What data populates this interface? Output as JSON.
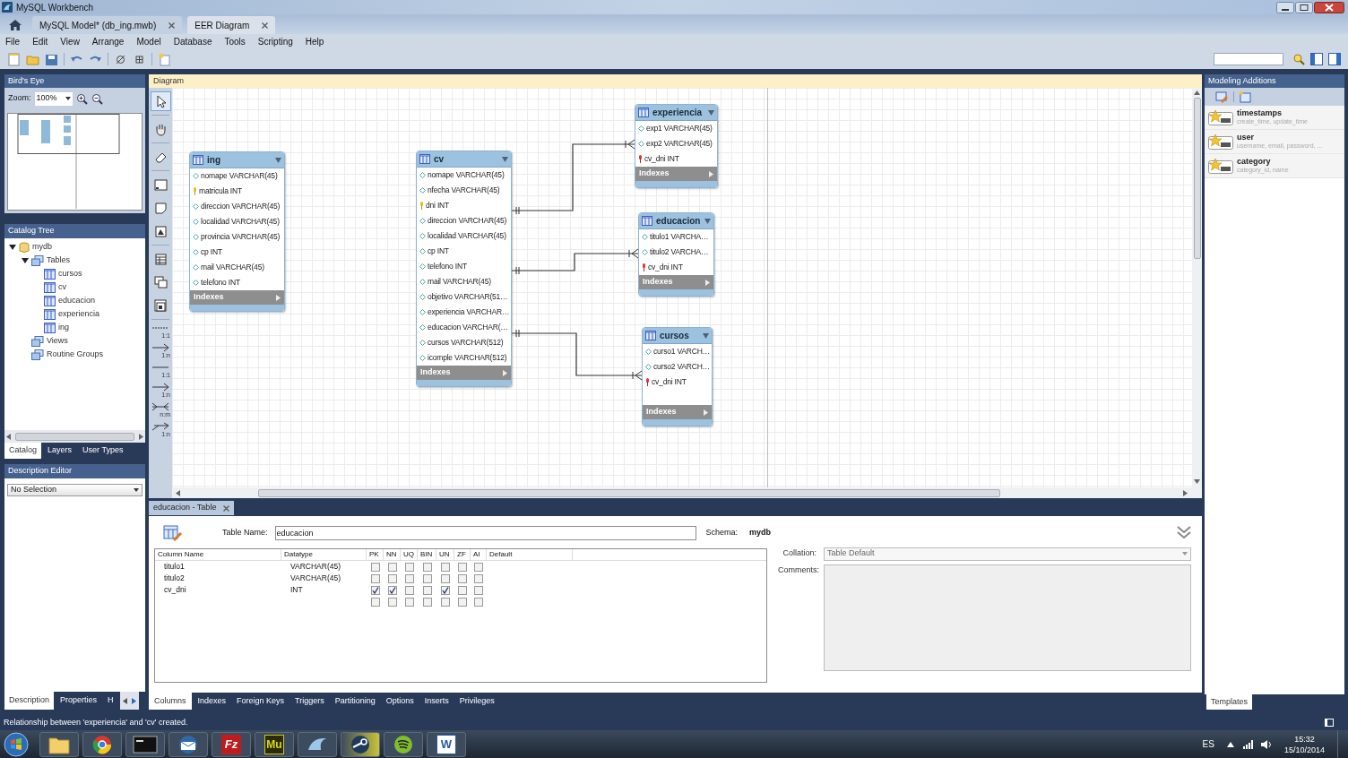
{
  "title_bar": {
    "title": "MySQL Workbench"
  },
  "document_tabs": [
    {
      "label": "MySQL Model* (db_ing.mwb)",
      "selected": false
    },
    {
      "label": "EER Diagram",
      "selected": true
    }
  ],
  "menu": [
    "File",
    "Edit",
    "View",
    "Arrange",
    "Model",
    "Database",
    "Tools",
    "Scripting",
    "Help"
  ],
  "birds_eye": {
    "title": "Bird's Eye",
    "zoom_label": "Zoom:",
    "zoom_value": "100%"
  },
  "catalog_tree": {
    "title": "Catalog Tree",
    "items": [
      {
        "label": "mydb",
        "kind": "schema",
        "expanded": true,
        "children": [
          {
            "label": "Tables",
            "kind": "folder",
            "expanded": true,
            "children": [
              {
                "label": "cursos",
                "kind": "table"
              },
              {
                "label": "cv",
                "kind": "table"
              },
              {
                "label": "educacion",
                "kind": "table"
              },
              {
                "label": "experiencia",
                "kind": "table"
              },
              {
                "label": "ing",
                "kind": "table"
              }
            ]
          },
          {
            "label": "Views",
            "kind": "folder"
          },
          {
            "label": "Routine Groups",
            "kind": "folder"
          }
        ]
      }
    ]
  },
  "catalog_tabs": [
    {
      "label": "Catalog",
      "selected": true
    },
    {
      "label": "Layers",
      "selected": false
    },
    {
      "label": "User Types",
      "selected": false
    }
  ],
  "description_editor": {
    "title": "Description Editor",
    "selection": "No Selection"
  },
  "left_bottom_tabs": [
    {
      "label": "Description",
      "selected": true
    },
    {
      "label": "Properties",
      "selected": false
    },
    {
      "label": "H",
      "selected": false
    }
  ],
  "diagram": {
    "title": "Diagram",
    "relationship_tools": [
      "1:1",
      "1:n",
      "1:1",
      "1:n",
      "n:m",
      "1:n"
    ],
    "tables": [
      {
        "name": "ing",
        "indexes_label": "Indexes",
        "columns": [
          {
            "text": "nomape VARCHAR(45)",
            "kind": "column"
          },
          {
            "text": "matricula INT",
            "kind": "pk"
          },
          {
            "text": "direccion VARCHAR(45)",
            "kind": "column"
          },
          {
            "text": "localidad VARCHAR(45)",
            "kind": "column"
          },
          {
            "text": "provincia VARCHAR(45)",
            "kind": "column"
          },
          {
            "text": "cp INT",
            "kind": "column"
          },
          {
            "text": "mail VARCHAR(45)",
            "kind": "column"
          },
          {
            "text": "telefono INT",
            "kind": "column"
          }
        ]
      },
      {
        "name": "cv",
        "indexes_label": "Indexes",
        "columns": [
          {
            "text": "nomape VARCHAR(45)",
            "kind": "column"
          },
          {
            "text": "nfecha VARCHAR(45)",
            "kind": "column"
          },
          {
            "text": "dni INT",
            "kind": "pk"
          },
          {
            "text": "direccion VARCHAR(45)",
            "kind": "column"
          },
          {
            "text": "localidad VARCHAR(45)",
            "kind": "column"
          },
          {
            "text": "cp INT",
            "kind": "column"
          },
          {
            "text": "telefono INT",
            "kind": "column"
          },
          {
            "text": "mail VARCHAR(45)",
            "kind": "column"
          },
          {
            "text": "objetivo VARCHAR(51…",
            "kind": "column"
          },
          {
            "text": "experiencia VARCHAR…",
            "kind": "column"
          },
          {
            "text": "educacion VARCHAR(…",
            "kind": "column"
          },
          {
            "text": "cursos VARCHAR(512)",
            "kind": "column"
          },
          {
            "text": "icomple VARCHAR(512)",
            "kind": "column"
          }
        ]
      },
      {
        "name": "experiencia",
        "indexes_label": "Indexes",
        "columns": [
          {
            "text": "exp1 VARCHAR(45)",
            "kind": "column"
          },
          {
            "text": "exp2 VARCHAR(45)",
            "kind": "column"
          },
          {
            "text": "cv_dni INT",
            "kind": "fk"
          }
        ]
      },
      {
        "name": "educacion",
        "indexes_label": "Indexes",
        "columns": [
          {
            "text": "titulo1 VARCHA…",
            "kind": "column"
          },
          {
            "text": "titulo2 VARCHA…",
            "kind": "column"
          },
          {
            "text": "cv_dni INT",
            "kind": "fk"
          }
        ]
      },
      {
        "name": "cursos",
        "indexes_label": "Indexes",
        "columns": [
          {
            "text": "curso1 VARCH…",
            "kind": "column"
          },
          {
            "text": "curso2 VARCH…",
            "kind": "column"
          },
          {
            "text": "cv_dni INT",
            "kind": "fk"
          }
        ]
      }
    ]
  },
  "editor": {
    "tab_label": "educacion - Table",
    "table_name_label": "Table Name:",
    "table_name": "educacion",
    "schema_label": "Schema:",
    "schema": "mydb",
    "headers": [
      "Column Name",
      "Datatype",
      "PK",
      "NN",
      "UQ",
      "BIN",
      "UN",
      "ZF",
      "AI",
      "Default"
    ],
    "rows": [
      {
        "name": "titulo1",
        "datatype": "VARCHAR(45)",
        "checks": [
          false,
          false,
          false,
          false,
          false,
          false,
          false
        ]
      },
      {
        "name": "titulo2",
        "datatype": "VARCHAR(45)",
        "checks": [
          false,
          false,
          false,
          false,
          false,
          false,
          false
        ]
      },
      {
        "name": "cv_dni",
        "datatype": "INT",
        "checks": [
          true,
          true,
          false,
          false,
          true,
          false,
          false
        ]
      },
      {
        "checks": [
          false,
          false,
          false,
          false,
          false,
          false,
          false
        ]
      }
    ],
    "collation_label": "Collation:",
    "collation": "Table Default",
    "comments_label": "Comments:"
  },
  "editor_tabs": [
    {
      "label": "Columns",
      "selected": true
    },
    {
      "label": "Indexes",
      "selected": false
    },
    {
      "label": "Foreign Keys",
      "selected": false
    },
    {
      "label": "Triggers",
      "selected": false
    },
    {
      "label": "Partitioning",
      "selected": false
    },
    {
      "label": "Options",
      "selected": false
    },
    {
      "label": "Inserts",
      "selected": false
    },
    {
      "label": "Privileges",
      "selected": false
    }
  ],
  "modeling_additions": {
    "title": "Modeling Additions",
    "items": [
      {
        "name": "timestamps",
        "fields": "create_time, update_time"
      },
      {
        "name": "user",
        "fields": "username, email, password, ..."
      },
      {
        "name": "category",
        "fields": "category_id, name"
      }
    ],
    "tab": "Templates"
  },
  "status_bar": "Relationship between 'experiencia' and 'cv' created.",
  "taskbar": {
    "apps": [
      {
        "kind": "folder"
      },
      {
        "kind": "browser"
      },
      {
        "kind": "terminal"
      },
      {
        "kind": "mail"
      },
      {
        "kind": "ftp",
        "glyph": "Fz"
      },
      {
        "kind": "muse",
        "glyph": "Mu"
      },
      {
        "kind": "dolphin"
      },
      {
        "kind": "steam"
      },
      {
        "kind": "music"
      },
      {
        "kind": "word",
        "glyph": "W"
      }
    ],
    "language": "ES",
    "time": "15:32",
    "date": "15/10/2014"
  }
}
